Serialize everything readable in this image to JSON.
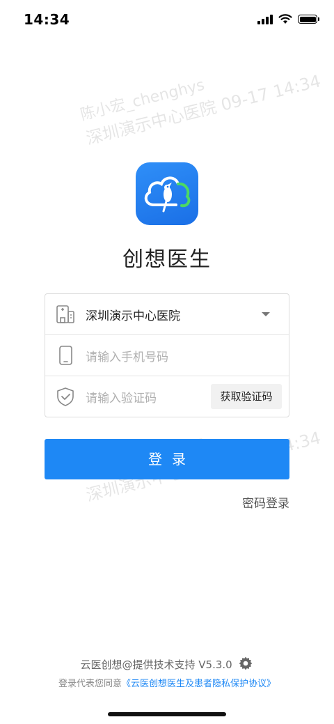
{
  "status_bar": {
    "time": "14:34"
  },
  "watermark": {
    "line1": "陈小宏_chenghys",
    "line2": "深圳演示中心医院  09-17 14:34"
  },
  "app": {
    "name": "创想医生"
  },
  "form": {
    "hospital": "深圳演示中心医院",
    "phone_placeholder": "请输入手机号码",
    "code_placeholder": "请输入验证码",
    "get_code_label": "获取验证码"
  },
  "login_label": "登录",
  "password_login_label": "密码登录",
  "footer": {
    "support_text": "云医创想@提供技术支持 V5.3.0",
    "agreement_prefix": "登录代表您同意",
    "agreement_link": "《云医创想医生及患者隐私保护协议》"
  },
  "colors": {
    "primary": "#1e88f5",
    "logo_bg": "#2f8ff8"
  },
  "icons": [
    "signal-icon",
    "wifi-icon",
    "battery-icon",
    "hospital-icon",
    "phone-icon",
    "shield-check-icon",
    "gear-icon"
  ]
}
